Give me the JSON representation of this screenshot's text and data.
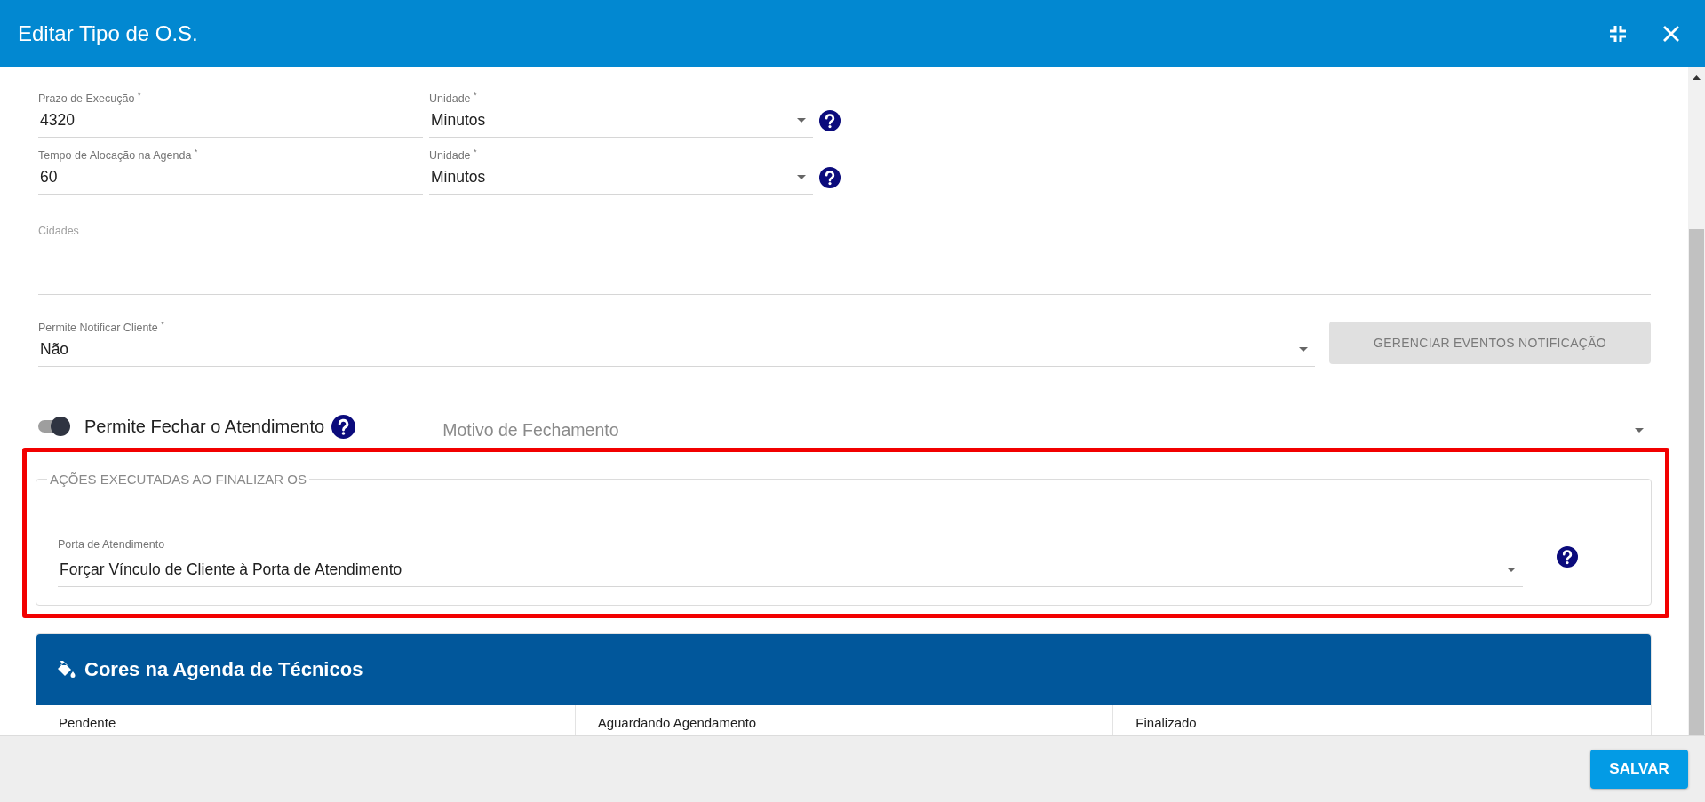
{
  "window": {
    "title": "Editar Tipo de O.S."
  },
  "rows": [
    {
      "field": {
        "label": "Prazo de Execução $^{*}$",
        "value": "4320"
      },
      "unit": {
        "label": "Unidade $^{*}$",
        "value": "Minutos"
      }
    },
    {
      "field": {
        "label": "Tempo de Alocação na Agenda $^{*}$",
        "value": "60"
      },
      "unit": {
        "label": "Unidade $^{*}$",
        "value": "Minutos"
      }
    }
  ],
  "cities": {
    "label": "Cidades"
  },
  "notify": {
    "label": "Permite Notificar Cliente $^{*}$",
    "value": "Não",
    "button": {
      "label": "GERENCIAR EVENTOS NOTIFICAÇÃO",
      "disabled": true
    }
  },
  "closing": {
    "toggle": {
      "label": "Permite Fechar o Atendimento",
      "on": true
    },
    "reason": {
      "placeholder": "Motivo de Fechamento"
    }
  },
  "section": {
    "legend": "AÇÕES EXECUTADAS AO FINALIZAR OS",
    "highlighted": true,
    "field": {
      "label": "Porta de Atendimento",
      "value": "Forçar Vínculo de Cliente à Porta de Atendimento"
    }
  },
  "colors_panel": {
    "title": "Cores na Agenda de Técnicos",
    "columns": [
      "Pendente",
      "Aguardando Agendamento",
      "Finalizado"
    ]
  },
  "footer": {
    "save": "SALVAR"
  }
}
